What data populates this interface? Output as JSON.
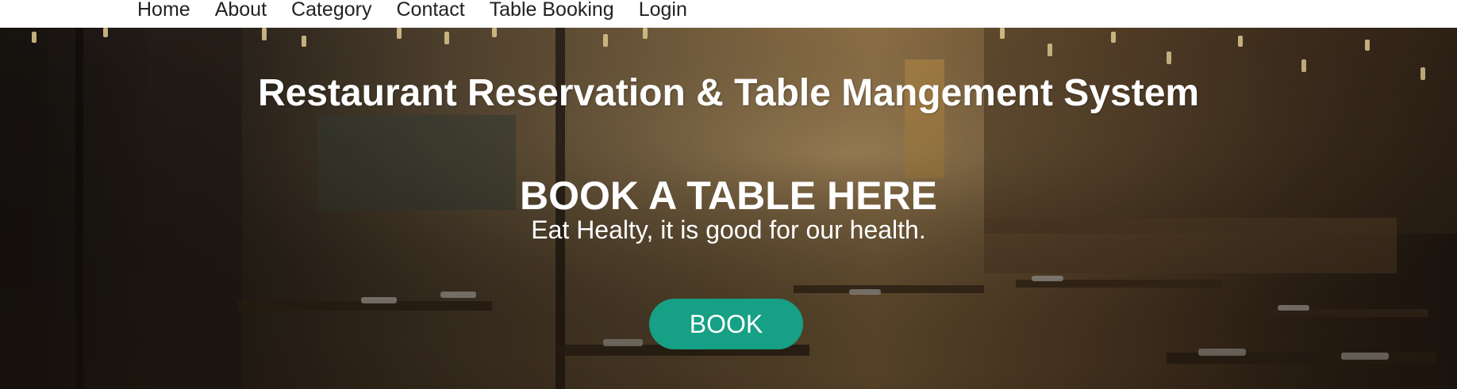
{
  "nav": {
    "items": [
      {
        "label": "Home"
      },
      {
        "label": "About"
      },
      {
        "label": "Category"
      },
      {
        "label": "Contact"
      },
      {
        "label": "Table Booking"
      },
      {
        "label": "Login"
      }
    ]
  },
  "hero": {
    "title": "Restaurant Reservation & Table Mangement System",
    "heading": "BOOK A TABLE HERE",
    "subtitle": "Eat Healty, it is good for our health.",
    "button_label": "BOOK",
    "button_color": "#16a085",
    "background_image": "restaurant-interior-photo"
  }
}
